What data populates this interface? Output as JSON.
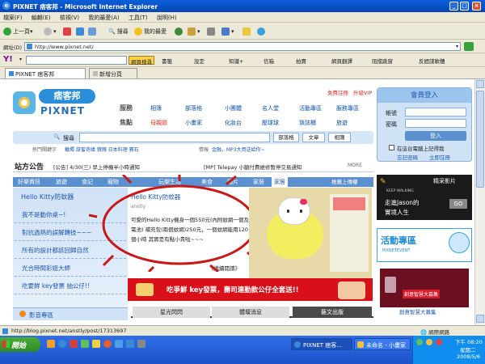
{
  "window": {
    "title": "PIXNET 痞客邦 - Microsoft Internet Explorer"
  },
  "menu": [
    "檔案(F)",
    "編輯(E)",
    "檢視(V)",
    "我的最愛(A)",
    "工具(T)",
    "說明(H)"
  ],
  "toolbar": {
    "back": "上一頁",
    "search": "搜尋",
    "favorites": "我的最愛"
  },
  "address": {
    "label": "網址(D)",
    "url": "http://www.pixnet.net/"
  },
  "yahoo_bar": {
    "search_btn": "網頁搜尋",
    "items": [
      "書籤",
      "設定",
      "知識+",
      "信箱",
      "拍賣",
      "網頁翻譯",
      "阻擋跳窗",
      "反間諜軟體"
    ]
  },
  "tabs": {
    "active": "PIXNET 痞客邦",
    "new_tab": "新增分頁"
  },
  "page": {
    "logo_cn": "痞客邦",
    "logo_en": "PIXNET",
    "topbar": {
      "register": "免費註冊",
      "upgrade": "升級VIP"
    },
    "categories": [
      {
        "head": "服務",
        "items": [
          "相簿",
          "部落格",
          "小團體",
          "名人堂",
          "活動專區",
          "服務專區"
        ]
      },
      {
        "head": "焦點",
        "items": [
          "母親節",
          "小畫家",
          "化妝台",
          "壓球球",
          "瑣誌櫃",
          "旅遊"
        ]
      }
    ],
    "search": {
      "label": "搜尋",
      "options": [
        "部落格",
        "文章",
        "相簿"
      ]
    },
    "hot": {
      "label": "熱門關鍵字",
      "text": "蠟燭 甜蜜奇緣 親親 日本料理 寶石",
      "label2": "情報",
      "text2": "金融，MP3大買送給你~"
    },
    "announce": {
      "title": "站方公告",
      "text": "[公告] 4/30(三) 早上停機半小時通知",
      "text2": "[MP] Telepay 小額付費維修暫停交易通知",
      "more": "MORE"
    },
    "navtabs": [
      "好樂資訊",
      "旅遊",
      "食記",
      "寵物",
      "玩樂生活",
      "美食",
      "圖片",
      "家居",
      "電影",
      "家居"
    ],
    "featured_btn": "推薦上傳樓",
    "side_title": "Hello Kitty防蚊器",
    "side_list": [
      "我不是動你桌~!",
      "對抗過熱的誤解轉技~~~",
      "所有的設計都該回歸自然",
      "光合時間彩姐大師",
      "吃要鮮 key發票 抽公仔!!"
    ],
    "side_section": "影音專區",
    "post": {
      "title": "Hello Kitty防蚊器",
      "author": "anstly",
      "body": "可愛的Hello Kitty機身一個550元(內附蚊網一個及電池) 補充包(兩個蚊網)250元，一個蚊網能用120個小時 其實是有點小貴啦~~~",
      "more": "《繼續閱讀》"
    },
    "banner": "吃爭鮮 key發票，壽司連勤款公仔全套送!!",
    "bottom_tabs": [
      "星光閃閃",
      "體壇消息",
      "藝文出版"
    ],
    "login": {
      "title": "會員登入",
      "account": "帳號",
      "password": "密碼",
      "button": "登入",
      "remember": "在這台電腦上記得我",
      "forgot": "忘記密碼",
      "register": "立即註冊"
    },
    "ad1": {
      "title": "走進Jason的",
      "sub": "實境人生",
      "go": "GO",
      "tag": "KEEP WALKING",
      "label": "精采影片"
    },
    "ad2": {
      "title": "活動專區",
      "tag": "PIXNETEVENT",
      "item": "創意智慧大募集"
    },
    "promo": "創意智慧大募集"
  },
  "status": {
    "url": "http://blog.pixnet.net/anstly/post/17313697",
    "zone": "網際網路"
  },
  "taskbar": {
    "start": "開始",
    "tasks": [
      "PIXNET 痞客...",
      "未命名 - 小畫家"
    ],
    "time": "下午 08:20",
    "day": "星期二",
    "date": "2008/5/6"
  }
}
